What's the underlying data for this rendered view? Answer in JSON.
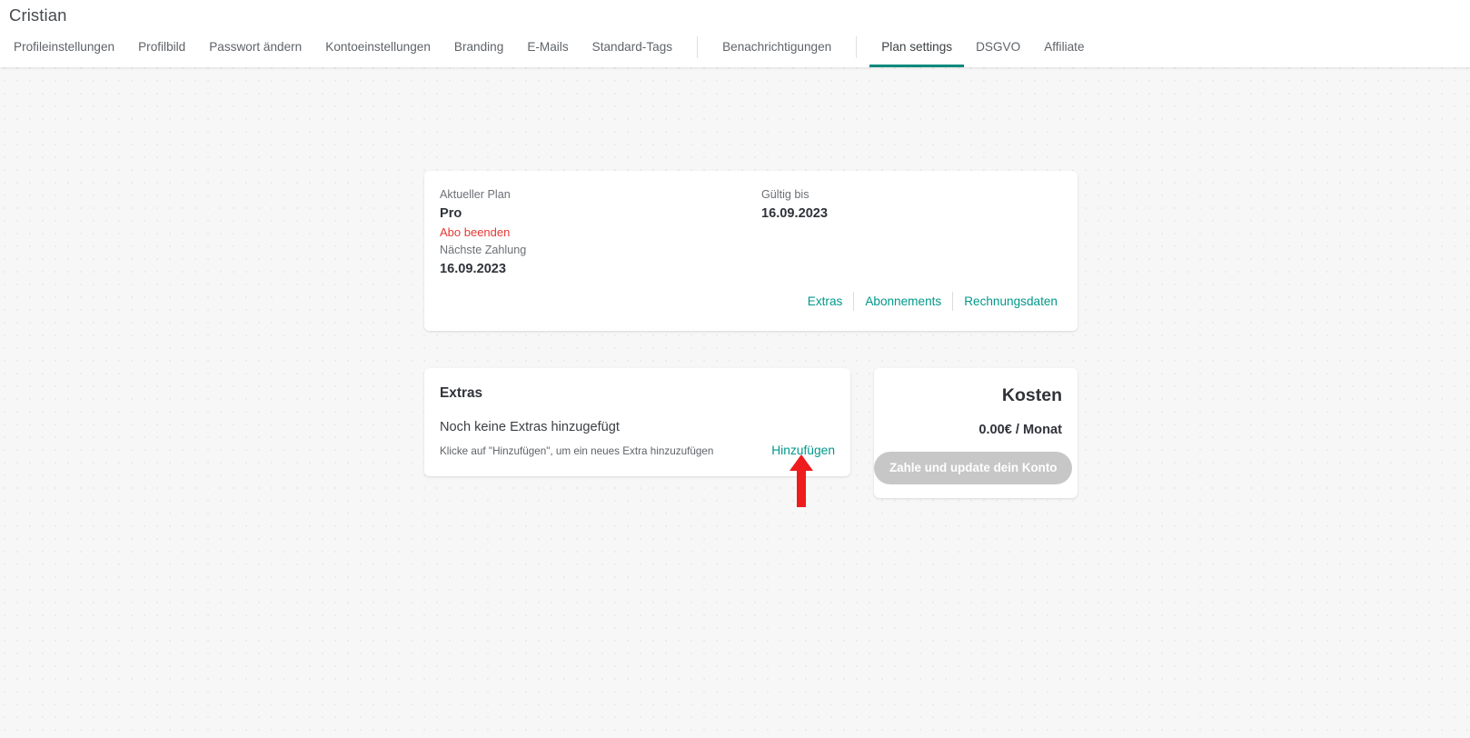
{
  "header": {
    "title": "Cristian",
    "tabs": [
      {
        "label": "Profileinstellungen",
        "active": false
      },
      {
        "label": "Profilbild",
        "active": false
      },
      {
        "label": "Passwort ändern",
        "active": false
      },
      {
        "label": "Kontoeinstellungen",
        "active": false
      },
      {
        "label": "Branding",
        "active": false
      },
      {
        "label": "E-Mails",
        "active": false
      },
      {
        "label": "Standard-Tags",
        "active": false
      },
      {
        "label": "Benachrichtigungen",
        "active": false
      },
      {
        "label": "Plan settings",
        "active": true
      },
      {
        "label": "DSGVO",
        "active": false
      },
      {
        "label": "Affiliate",
        "active": false
      }
    ]
  },
  "plan_card": {
    "current_plan_label": "Aktueller Plan",
    "current_plan_value": "Pro",
    "cancel_link": "Abo beenden",
    "valid_until_label": "Gültig bis",
    "valid_until_value": "16.09.2023",
    "next_payment_label": "Nächste Zahlung",
    "next_payment_value": "16.09.2023",
    "links": [
      {
        "label": "Extras"
      },
      {
        "label": "Abonnements"
      },
      {
        "label": "Rechnungsdaten"
      }
    ]
  },
  "extras_card": {
    "title": "Extras",
    "empty_message": "Noch keine Extras hinzugefügt",
    "hint": "Klicke auf \"Hinzufügen\", um ein neues Extra hinzuzufügen",
    "add_link": "Hinzufügen"
  },
  "kosten_card": {
    "title": "Kosten",
    "price": "0.00€ / Monat",
    "pay_button": "Zahle und update dein Konto"
  },
  "annotation": {
    "arrow": "up-arrow-icon",
    "color": "#ee1c1c",
    "points_at": "Hinzufügen"
  },
  "colors": {
    "accent_teal": "#00988a",
    "danger_red": "#e53935",
    "annotation_red": "#ee1c1c",
    "background": "#f7f7f7",
    "card_white": "#ffffff",
    "disabled_button": "#c7c7c7"
  }
}
